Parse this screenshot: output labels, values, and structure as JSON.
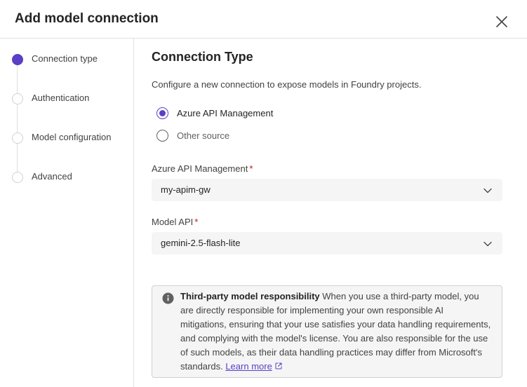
{
  "dialog": {
    "title": "Add model connection"
  },
  "steps": [
    {
      "label": "Connection type",
      "active": true
    },
    {
      "label": "Authentication",
      "active": false
    },
    {
      "label": "Model configuration",
      "active": false
    },
    {
      "label": "Advanced",
      "active": false
    }
  ],
  "main": {
    "section_title": "Connection Type",
    "description": "Configure a new connection to expose models in Foundry projects.",
    "source_options": [
      {
        "label": "Azure API Management",
        "selected": true
      },
      {
        "label": "Other source",
        "selected": false
      }
    ],
    "apim_field": {
      "label": "Azure API Management",
      "required_mark": "*",
      "value": "my-apim-gw"
    },
    "model_api_field": {
      "label": "Model API",
      "required_mark": "*",
      "value": "gemini-2.5-flash-lite"
    },
    "notice": {
      "title": "Third-party model responsibility",
      "body": "When you use a third-party model, you are directly responsible for implementing your own responsible AI mitigations, ensuring that your use satisfies your data handling requirements, and complying with the model's license. You are also responsible for the use of such models, as their data handling practices may differ from Microsoft's standards.",
      "link_label": "Learn more"
    }
  },
  "icons": {
    "close": "close-icon",
    "chevron": "chevron-down-icon",
    "info": "info-icon",
    "external": "external-link-icon"
  },
  "colors": {
    "accent": "#5b3fc4",
    "required": "#c50f1f",
    "field_bg": "#f5f5f5",
    "border": "#e0e0e0"
  }
}
